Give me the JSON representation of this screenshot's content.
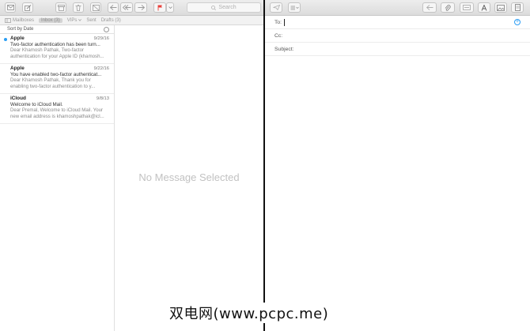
{
  "mail": {
    "search_placeholder": "Search",
    "favorites": {
      "mailboxes": "Mailboxes",
      "inbox": "Inbox (3)",
      "vips": "VIPs",
      "sent": "Sent",
      "drafts": "Drafts (3)"
    },
    "sort_label": "Sort by Date",
    "messages": [
      {
        "from": "Apple",
        "date": "9/29/16",
        "subject": "Two-factor authentication has been turn...",
        "preview": "Dear Khamosh Pathak, Two-factor authentication for your Apple ID (khamosh...",
        "unread": true
      },
      {
        "from": "Apple",
        "date": "9/22/16",
        "subject": "You have enabled two-factor authenticat...",
        "preview": "Dear Khamosh Pathak, Thank you for enabling two-factor authentication to y...",
        "unread": false
      },
      {
        "from": "iCloud",
        "date": "9/8/13",
        "subject": "Welcome to iCloud Mail.",
        "preview": "Dear Premal, Welcome to iCloud Mail. Your new email address is khamoshpathak@icl...",
        "unread": false
      }
    ],
    "no_message": "No Message Selected"
  },
  "compose": {
    "to_label": "To:",
    "cc_label": "Cc:",
    "subject_label": "Subject:"
  },
  "watermark": "双电网(www.pcpc.me)",
  "colors": {
    "accent": "#2a9df4",
    "flag": "#e8403a"
  }
}
